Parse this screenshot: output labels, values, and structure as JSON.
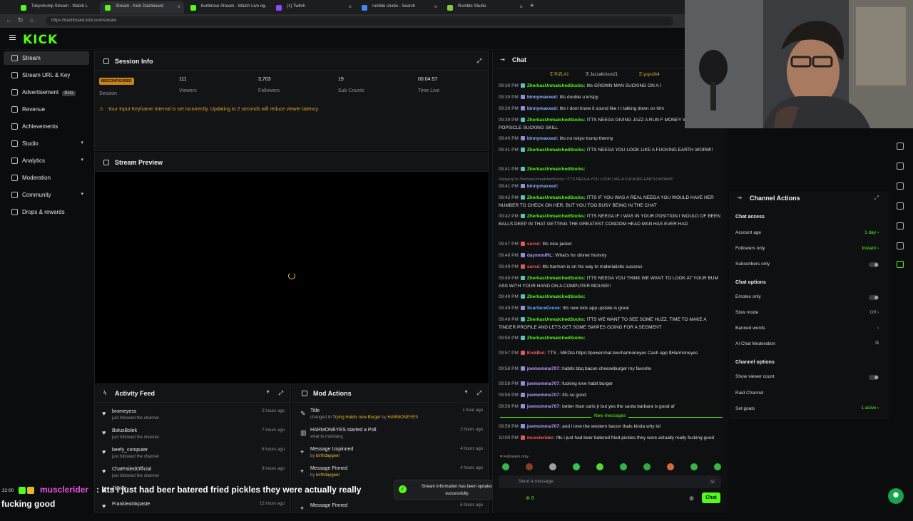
{
  "browser": {
    "tabs": [
      {
        "label": "Tokyotrump Stream - Watch L",
        "color": "#53fc18"
      },
      {
        "label": "Stream - Kick Dashboard",
        "color": "#53fc18"
      },
      {
        "label": "burtbrose Stream - Watch Live on",
        "color": "#53fc18"
      },
      {
        "label": "(1) Twitch",
        "color": "#9146ff"
      },
      {
        "label": "rumble studio - Search",
        "color": "#4285f4"
      },
      {
        "label": "Rumble Studio",
        "color": "#85c742"
      }
    ],
    "url": "https://dashboard.kick.com/stream"
  },
  "logo": "KICK",
  "sidebar": {
    "items": [
      {
        "label": "Stream",
        "active": true
      },
      {
        "label": "Stream URL & Key"
      },
      {
        "label": "Advertisement",
        "badge": "Beta"
      },
      {
        "label": "Revenue"
      },
      {
        "label": "Achievements"
      },
      {
        "label": "Studio",
        "chevron": true
      },
      {
        "label": "Analytics",
        "chevron": true
      },
      {
        "label": "Moderation"
      },
      {
        "label": "Community",
        "chevron": true
      },
      {
        "label": "Drops & rewards"
      }
    ]
  },
  "session": {
    "title": "Session Info",
    "badge": "MISCONFIGURED",
    "badge_label": "Session",
    "viewers": "111",
    "viewers_label": "Viewers",
    "followers": "3,703",
    "followers_label": "Followers",
    "subs": "19",
    "subs_label": "Sub Counts",
    "time": "00:04:57",
    "time_label": "Time Live",
    "warning": "Your Input Keyframe Interval is set incorrectly. Updating to 2 seconds will reduce viewer latency."
  },
  "preview": {
    "title": "Stream Preview"
  },
  "activity": {
    "title": "Activity Feed",
    "rows": [
      {
        "name": "bromeyess",
        "sub": "just followed the channel",
        "time": "2 hours ago"
      },
      {
        "name": "BolusBolek",
        "sub": "just followed the channel",
        "time": "7 hours ago"
      },
      {
        "name": "beefy_computer",
        "sub": "just followed the channel",
        "time": "8 hours ago"
      },
      {
        "name": "ChatFailedOfficial",
        "sub": "just followed the channel",
        "time": "9 hours ago"
      },
      {
        "name": "Jbaide",
        "sub": "",
        "time": ""
      },
      {
        "name": "Frankieoinkpaste",
        "sub": "",
        "time": "12 hours ago"
      }
    ]
  },
  "mod": {
    "title": "Mod Actions",
    "rows": [
      {
        "name": "Title",
        "sub_a": "changed to ",
        "sub_b": "Trying Habits new Burger",
        "sub_c": " by ",
        "sub_d": "HARMONEYES",
        "time": "1 hour ago"
      },
      {
        "name": "HARMONEYES started a Poll",
        "sub_a": "what to mukbang",
        "time": "2 hours ago"
      },
      {
        "name": "Message Unpinned",
        "sub_a": "by ",
        "sub_d": "birthdaygeer",
        "time": "4 hours ago"
      },
      {
        "name": "Message Pinned",
        "sub_a": "by ",
        "sub_d": "birthdaygeer",
        "time": "4 hours ago"
      },
      {
        "name": "Message Pinned",
        "sub_a": "",
        "time": "6 hours ago"
      }
    ]
  },
  "toast": "Stream information has been updated successfully.",
  "chat": {
    "title": "Chat",
    "top_gifters": [
      "RIZLA1",
      "Jazzalicious21",
      "yoyo2k4"
    ],
    "messages": [
      {
        "t": "09:39 PM",
        "u": "ZherkasUnmatchedSocks:",
        "c": "green",
        "m": "Itts GROWN MAN SUCKING ON A I"
      },
      {
        "t": "09:39 PM",
        "u": "binnymaxxed:",
        "c": "bluey",
        "m": "Itts double u krispy"
      },
      {
        "t": "09:39 PM",
        "u": "binnymaxxed:",
        "c": "bluey",
        "m": "Itts I dont know it sound like t t talking down on him"
      },
      {
        "t": "09:39 PM",
        "u": "ZherkasUnmatchedSocks:",
        "c": "green",
        "m": "ITTS NEEGA GIVING JAZZ A RUN F MONEY WITH THAT POPSICLE SUCKING SKILL"
      },
      {
        "t": "09:40 PM",
        "u": "binnymaxxed:",
        "c": "bluey",
        "m": "Itts no tokyo trump thermy"
      },
      {
        "t": "09:41 PM",
        "u": "ZherkasUnmatchedSocks:",
        "c": "green",
        "m": "ITTS NEEGA YOU LOOK LIKE A FUCKING EARTH WORM!!"
      },
      {
        "t": "09:41 PM",
        "u": "ZherkasUnmatchedSocks:",
        "c": "green",
        "m": ""
      },
      {
        "t": "",
        "u": "",
        "c": "",
        "m": "Replying to ZherkasUnmatchedSocks: ITTS NEEGA YOU LOOK LIKE A FUCKING EARTH WORM!!"
      },
      {
        "t": "09:41 PM",
        "u": "binnymaxxed:",
        "c": "bluey",
        "m": ""
      },
      {
        "t": "09:42 PM",
        "u": "ZherkasUnmatchedSocks:",
        "c": "green",
        "m": "ITTS IF YOU WAS A REAL NEEGA YOU WOULD HAVE HER NUMBER TO CHECK ON HER. BUT YOU TOO BUSY BEING IN THE CHAT"
      },
      {
        "t": "09:42 PM",
        "u": "ZherkasUnmatchedSocks:",
        "c": "green",
        "m": "ITTS NEEGA IF I WAS IN YOUR POSITION I WOULD OF BEEN BALLS DEEP IN THAT GETTING THE GREATEST CONDOM HEAD MAN HAS EVER HAD"
      },
      {
        "t": "09:47 PM",
        "u": "surcé:",
        "c": "redish",
        "m": "Itts nice jacket"
      },
      {
        "t": "09:48 PM",
        "u": "daymonIRL:",
        "c": "purple",
        "m": "What's for dinner hommy"
      },
      {
        "t": "09:49 PM",
        "u": "surcé:",
        "c": "redish",
        "m": "Itts harmon is on his way to materialistic success"
      },
      {
        "t": "09:49 PM",
        "u": "ZherkasUnmatchedSocks:",
        "c": "green",
        "m": "ITTS NEEGA YOU THINK WE WANT TO LOOK AT YOUR BUM ASS WITH YOUR HAND ON A COMPUTER MOUSE!!"
      },
      {
        "t": "09:49 PM",
        "u": "ZherkasUnmatchedSocks:",
        "c": "green",
        "m": ""
      },
      {
        "t": "09:49 PM",
        "u": "ScarfaceGrove:",
        "c": "blue-u",
        "m": "Itts new kick app update is great"
      },
      {
        "t": "09:49 PM",
        "u": "ZherkasUnmatchedSocks:",
        "c": "green",
        "m": "ITTS WE WANT TO SEE SOME HUZZ. TIME TO MAKE A TINDER PROFILE AND LETS GET SOME SWIPES GOING FOR A SEGMENT"
      },
      {
        "t": "09:50 PM",
        "u": "ZherkasUnmatchedSocks:",
        "c": "green",
        "m": ""
      },
      {
        "t": "09:57 PM",
        "u": "KickBot:",
        "c": "redish",
        "m": "TTS - MEDIA https://powerchat.live/harmoneyes Cash app $Harmoneyes"
      },
      {
        "t": "09:58 PM",
        "u": "joemomma707:",
        "c": "purple",
        "m": "habits bbq bacon cheeseburger my favorite"
      },
      {
        "t": "09:58 PM",
        "u": "joemomma707:",
        "c": "purple",
        "m": "fucking love habit burger"
      },
      {
        "t": "09:59 PM",
        "u": "joemomma707:",
        "c": "purple",
        "m": "Itts so good"
      },
      {
        "t": "09:59 PM",
        "u": "joemomma707:",
        "c": "purple",
        "m": "better than carls jr but yes the santa barbara is good af"
      },
      {
        "t": "09:59 PM",
        "u": "joemomma707:",
        "c": "purple",
        "m": "and i love the western bacon thats kinda why lol"
      },
      {
        "t": "10:00 PM",
        "u": "musclerider:",
        "c": "redish",
        "m": "Itts i just had beer batered fried pickles they were actually really fucking good"
      }
    ],
    "new_messages": "New messages",
    "followers_only": "Followers only",
    "input_placeholder": "Send a message",
    "count": "0",
    "send": "Chat"
  },
  "actions": {
    "title": "Channel Actions",
    "access_title": "Chat access",
    "account_age": "Account age",
    "account_age_val": "1 day",
    "followers_only": "Followers only",
    "followers_only_val": "Instant",
    "subscribers_only": "Subscribers only",
    "options_title": "Chat options",
    "emotes_only": "Emotes only",
    "slow_mode": "Slow mode",
    "slow_mode_val": "Off",
    "banned_words": "Banned words",
    "ai_mod": "AI Chat Moderation",
    "channel_title": "Channel options",
    "viewer_count": "Show viewer count",
    "raid": "Raid Channel",
    "goals": "Set goals",
    "goals_val": "1 active"
  },
  "overlay": {
    "time": "22:00",
    "user": "musclerider",
    "msg1": ": Itts i just had beer batered fried pickles they were actually really",
    "msg2": "fucking good"
  }
}
